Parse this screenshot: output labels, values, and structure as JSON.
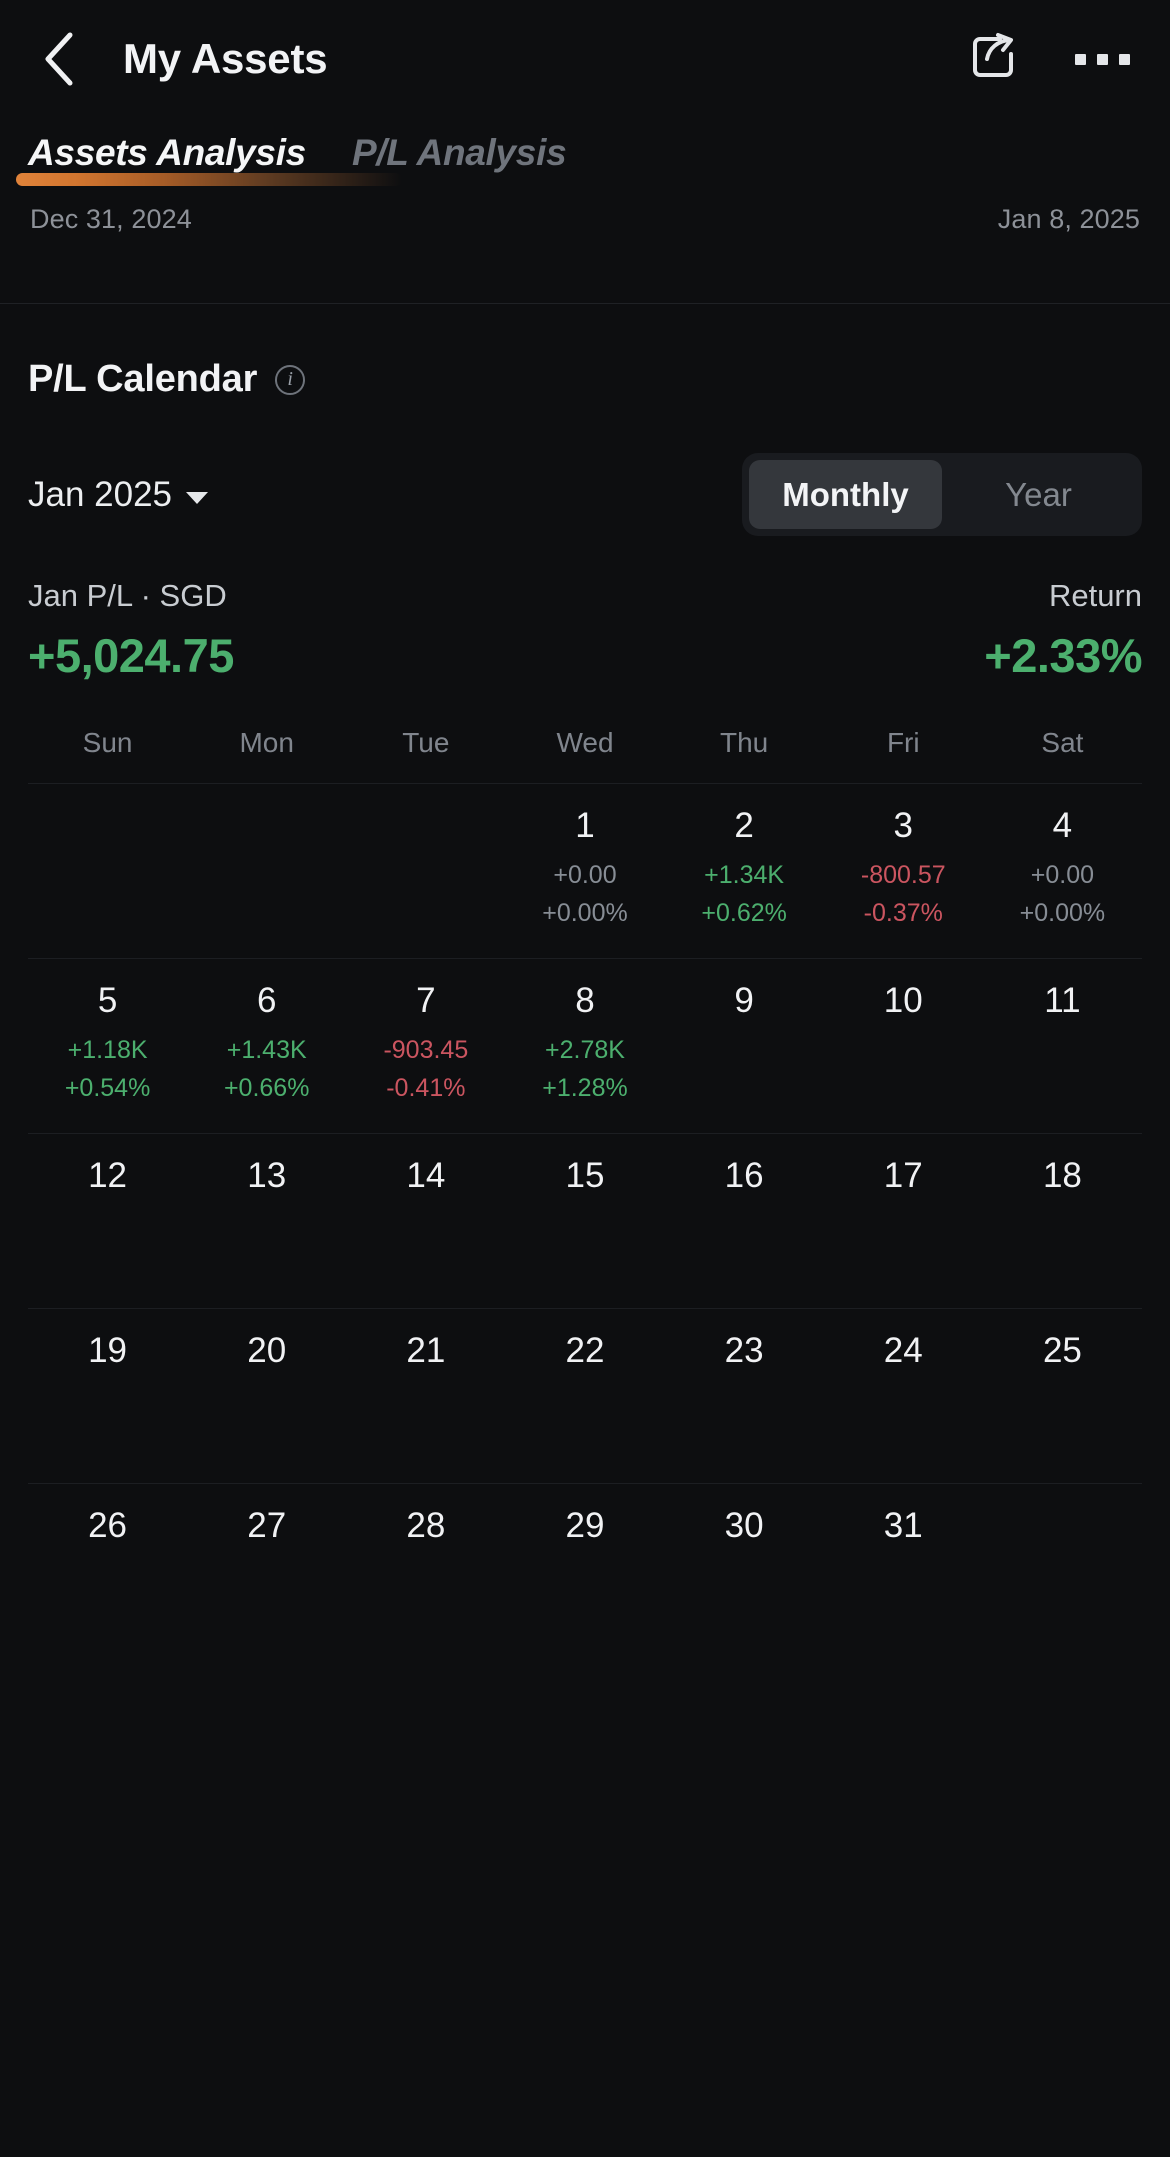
{
  "header": {
    "back_icon": "chevron-left-icon",
    "title": "My Assets",
    "share_icon": "share-icon",
    "more_icon": "more-options-icon"
  },
  "tabs": [
    {
      "label": "Assets Analysis",
      "active": true
    },
    {
      "label": "P/L Analysis",
      "active": false
    }
  ],
  "date_range": {
    "start": "Dec 31, 2024",
    "end": "Jan 8, 2025"
  },
  "calendar_section": {
    "title": "P/L Calendar",
    "info_icon": "info-icon",
    "info_glyph": "i",
    "month_selector": {
      "label": "Jan 2025",
      "caret_icon": "chevron-down-icon"
    },
    "range_toggle": {
      "options": [
        "Monthly",
        "Year"
      ],
      "selected": "Monthly"
    },
    "summary": {
      "pl_label": "Jan P/L · SGD",
      "pl_value": "+5,024.75",
      "pl_sign": "pos",
      "return_label": "Return",
      "return_value": "+2.33%",
      "return_sign": "pos"
    },
    "weekday_headers": [
      "Sun",
      "Mon",
      "Tue",
      "Wed",
      "Thu",
      "Fri",
      "Sat"
    ],
    "colors": {
      "positive": "#4caf6e",
      "negative": "#cb5560",
      "zero": "#878d95",
      "accent": "#e0833a",
      "background": "#0d0e10"
    },
    "weeks": [
      [
        {
          "day": "",
          "amount": "",
          "percent": "",
          "sign": ""
        },
        {
          "day": "",
          "amount": "",
          "percent": "",
          "sign": ""
        },
        {
          "day": "",
          "amount": "",
          "percent": "",
          "sign": ""
        },
        {
          "day": "1",
          "amount": "+0.00",
          "percent": "+0.00%",
          "sign": "zero"
        },
        {
          "day": "2",
          "amount": "+1.34K",
          "percent": "+0.62%",
          "sign": "pos"
        },
        {
          "day": "3",
          "amount": "-800.57",
          "percent": "-0.37%",
          "sign": "neg"
        },
        {
          "day": "4",
          "amount": "+0.00",
          "percent": "+0.00%",
          "sign": "zero"
        }
      ],
      [
        {
          "day": "5",
          "amount": "+1.18K",
          "percent": "+0.54%",
          "sign": "pos"
        },
        {
          "day": "6",
          "amount": "+1.43K",
          "percent": "+0.66%",
          "sign": "pos"
        },
        {
          "day": "7",
          "amount": "-903.45",
          "percent": "-0.41%",
          "sign": "neg"
        },
        {
          "day": "8",
          "amount": "+2.78K",
          "percent": "+1.28%",
          "sign": "pos"
        },
        {
          "day": "9",
          "amount": "",
          "percent": "",
          "sign": ""
        },
        {
          "day": "10",
          "amount": "",
          "percent": "",
          "sign": ""
        },
        {
          "day": "11",
          "amount": "",
          "percent": "",
          "sign": ""
        }
      ],
      [
        {
          "day": "12",
          "amount": "",
          "percent": "",
          "sign": ""
        },
        {
          "day": "13",
          "amount": "",
          "percent": "",
          "sign": ""
        },
        {
          "day": "14",
          "amount": "",
          "percent": "",
          "sign": ""
        },
        {
          "day": "15",
          "amount": "",
          "percent": "",
          "sign": ""
        },
        {
          "day": "16",
          "amount": "",
          "percent": "",
          "sign": ""
        },
        {
          "day": "17",
          "amount": "",
          "percent": "",
          "sign": ""
        },
        {
          "day": "18",
          "amount": "",
          "percent": "",
          "sign": ""
        }
      ],
      [
        {
          "day": "19",
          "amount": "",
          "percent": "",
          "sign": ""
        },
        {
          "day": "20",
          "amount": "",
          "percent": "",
          "sign": ""
        },
        {
          "day": "21",
          "amount": "",
          "percent": "",
          "sign": ""
        },
        {
          "day": "22",
          "amount": "",
          "percent": "",
          "sign": ""
        },
        {
          "day": "23",
          "amount": "",
          "percent": "",
          "sign": ""
        },
        {
          "day": "24",
          "amount": "",
          "percent": "",
          "sign": ""
        },
        {
          "day": "25",
          "amount": "",
          "percent": "",
          "sign": ""
        }
      ],
      [
        {
          "day": "26",
          "amount": "",
          "percent": "",
          "sign": ""
        },
        {
          "day": "27",
          "amount": "",
          "percent": "",
          "sign": ""
        },
        {
          "day": "28",
          "amount": "",
          "percent": "",
          "sign": ""
        },
        {
          "day": "29",
          "amount": "",
          "percent": "",
          "sign": ""
        },
        {
          "day": "30",
          "amount": "",
          "percent": "",
          "sign": ""
        },
        {
          "day": "31",
          "amount": "",
          "percent": "",
          "sign": ""
        },
        {
          "day": "",
          "amount": "",
          "percent": "",
          "sign": ""
        }
      ]
    ]
  }
}
